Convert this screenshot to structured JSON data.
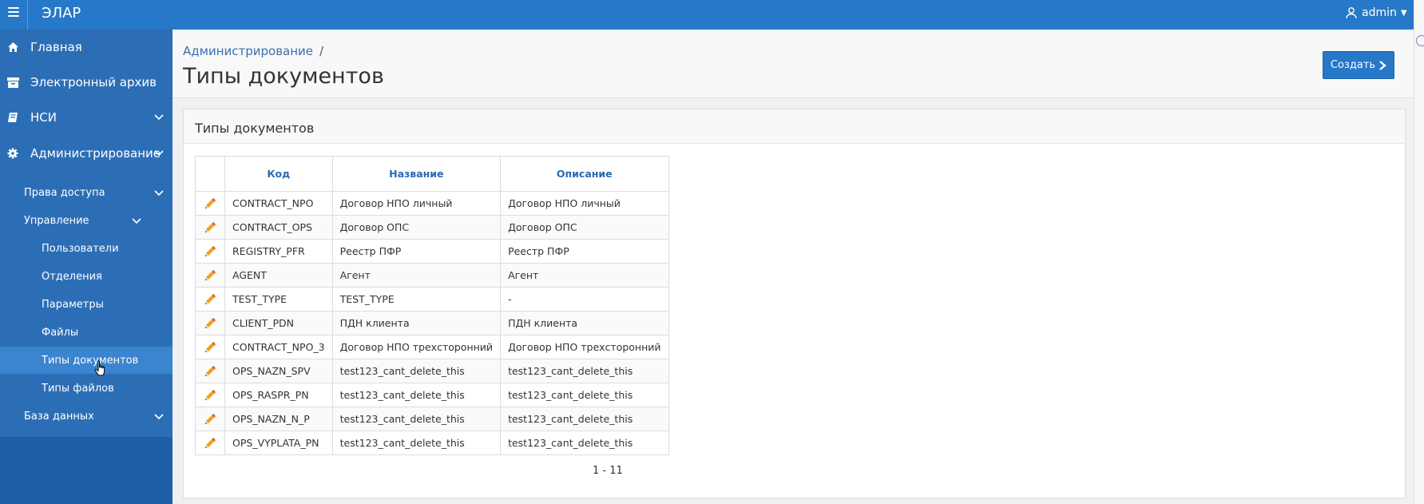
{
  "app": {
    "brand": "ЭЛАР",
    "user": "admin"
  },
  "colors": {
    "topbar": "#2678c8",
    "sidebar": "#2c6eb6",
    "accent": "#2678c8",
    "pencil": "#f0a020"
  },
  "sidebar": {
    "main_items": [
      {
        "label": "Главная",
        "icon": "home-icon"
      },
      {
        "label": "Электронный архив",
        "icon": "archive-icon"
      },
      {
        "label": "НСИ",
        "icon": "book-icon"
      },
      {
        "label": "Администрирование",
        "icon": "gear-icon"
      }
    ],
    "sub_items": {
      "access_rights": "Права доступа",
      "management": "Управление",
      "users": "Пользователи",
      "departments": "Отделения",
      "parameters": "Параметры",
      "files": "Файлы",
      "document_types": "Типы документов",
      "file_types": "Типы файлов",
      "database": "База данных"
    }
  },
  "header": {
    "breadcrumb": "Администрирование",
    "breadcrumb_sep": "/",
    "title": "Типы документов",
    "create_button": "Создать"
  },
  "panel": {
    "title": "Типы документов",
    "columns": {
      "code": "Код",
      "name": "Название",
      "description": "Описание"
    },
    "rows": [
      {
        "code": "CONTRACT_NPO",
        "name": "Договор НПО личный",
        "description": "Договор НПО личный"
      },
      {
        "code": "CONTRACT_OPS",
        "name": "Договор ОПС",
        "description": "Договор ОПС"
      },
      {
        "code": "REGISTRY_PFR",
        "name": "Реестр ПФР",
        "description": "Реестр ПФР"
      },
      {
        "code": "AGENT",
        "name": "Агент",
        "description": "Агент"
      },
      {
        "code": "TEST_TYPE",
        "name": "TEST_TYPE",
        "description": "-"
      },
      {
        "code": "CLIENT_PDN",
        "name": "ПДН клиента",
        "description": "ПДН клиента"
      },
      {
        "code": "CONTRACT_NPO_3",
        "name": "Договор НПО трехсторонний",
        "description": "Договор НПО трехсторонний"
      },
      {
        "code": "OPS_NAZN_SPV",
        "name": "test123_cant_delete_this",
        "description": "test123_cant_delete_this"
      },
      {
        "code": "OPS_RASPR_PN",
        "name": "test123_cant_delete_this",
        "description": "test123_cant_delete_this"
      },
      {
        "code": "OPS_NAZN_N_P",
        "name": "test123_cant_delete_this",
        "description": "test123_cant_delete_this"
      },
      {
        "code": "OPS_VYPLATA_PN",
        "name": "test123_cant_delete_this",
        "description": "test123_cant_delete_this"
      }
    ],
    "pagination": "1 - 11"
  }
}
